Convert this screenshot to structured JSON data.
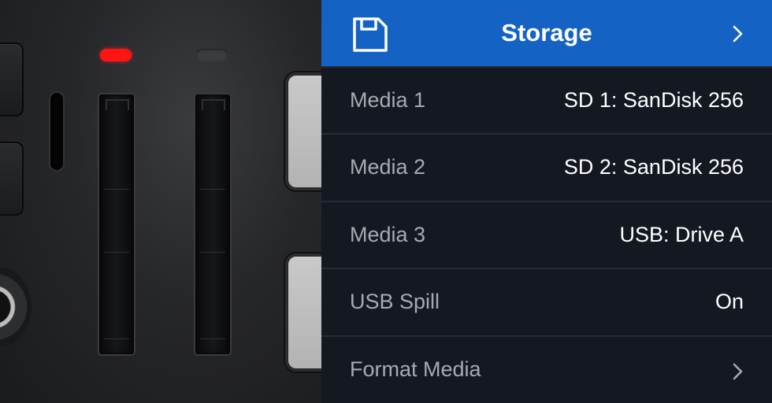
{
  "header": {
    "title": "Storage",
    "icon": "save-icon",
    "chevron": "chevron-right-icon",
    "color": "#1463c4"
  },
  "rows": [
    {
      "label": "Media 1",
      "value": "SD 1: SanDisk 256"
    },
    {
      "label": "Media 2",
      "value": "SD 2: SanDisk 256"
    },
    {
      "label": "Media 3",
      "value": "USB: Drive A"
    },
    {
      "label": "USB Spill",
      "value": "On"
    },
    {
      "label": "Format Media",
      "chevron": "chevron-right-icon"
    }
  ],
  "hardware": {
    "led_left": "red",
    "led_right": "off"
  }
}
